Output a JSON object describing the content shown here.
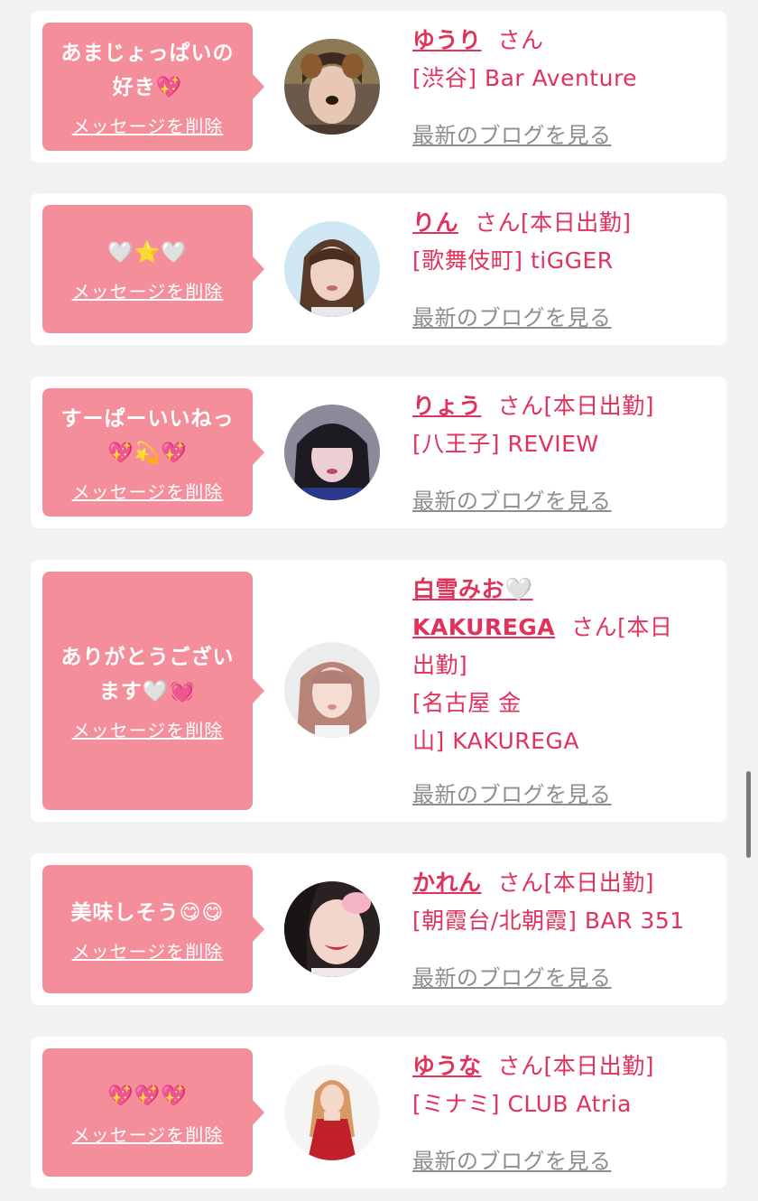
{
  "delete_label": "メッセージを削除",
  "blog_label": "最新のブログを見る",
  "san_label": "さん",
  "cards": [
    {
      "message_l1": "あまじょっぱいの",
      "message_l2": "好き💖",
      "name": "ゆうり",
      "attendance": "",
      "shop": "[渋谷] Bar Aventure"
    },
    {
      "message_l1": "🤍⭐🤍",
      "message_l2": "",
      "name": "りん",
      "attendance": "[本日出勤]",
      "shop": "[歌舞伎町] tiGGER"
    },
    {
      "message_l1": "すーぱーいいねっ",
      "message_l2": "💖💫💖",
      "name": "りょう",
      "attendance": "[本日出勤]",
      "shop": "[八王子] REVIEW"
    },
    {
      "message_l1": "ありがとうござい",
      "message_l2": "ます🤍💓",
      "name_l1": "白雪みお🤍",
      "name_l2": "KAKUREGA",
      "attendance_l1": "[本日",
      "attendance_l2": "出勤]",
      "shop_l1": "[名古屋 金",
      "shop_l2": "山] KAKUREGA"
    },
    {
      "message_l1": "美味しそう😋😋",
      "message_l2": "",
      "name": "かれん",
      "attendance": "[本日出勤]",
      "shop": "[朝霞台/北朝霞] BAR 351"
    },
    {
      "message_l1": "💖💖💖",
      "message_l2": "",
      "name": "ゆうな",
      "attendance": "[本日出勤]",
      "shop": "[ミナミ] CLUB Atria"
    }
  ],
  "colors": {
    "bubble": "#f58e9b",
    "name": "#e0335c",
    "link_gray": "#8e8e8e",
    "background": "#f2f2f2"
  }
}
